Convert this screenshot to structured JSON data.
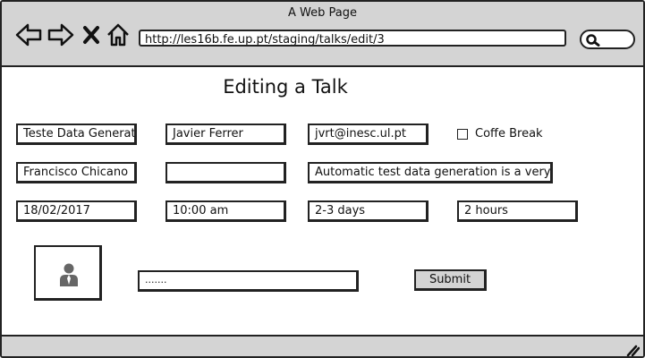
{
  "window": {
    "title": "A Web Page"
  },
  "toolbar": {
    "icons": [
      "back-arrow-icon",
      "forward-arrow-icon",
      "close-x-icon",
      "home-icon",
      "search-icon"
    ],
    "url": "http://les16b.fe.up.pt/staging/talks/edit/3"
  },
  "page": {
    "heading": "Editing a Talk"
  },
  "form": {
    "row1": {
      "title": "Teste Data Generation",
      "speaker": "Javier Ferrer",
      "email": "jvrt@inesc.ul.pt",
      "coffee_break_label": "Coffe Break",
      "coffee_break_checked": false
    },
    "row2": {
      "name": "Francisco Chicano",
      "empty_field": "",
      "description": "Automatic test data generation is a very popular topic"
    },
    "row3": {
      "date": "18/02/2017",
      "time": "10:00 am",
      "duration_days": "2-3 days",
      "duration_hours": "2 hours"
    },
    "photo": {
      "icon": "user-icon",
      "file_placeholder": "......."
    },
    "submit_label": "Submit"
  }
}
